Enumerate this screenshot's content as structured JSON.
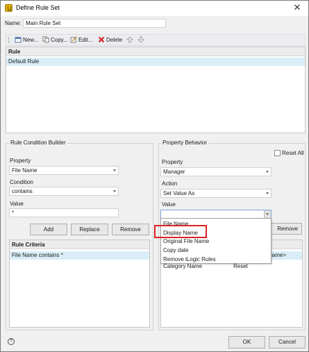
{
  "window": {
    "title": "Define Rule Set"
  },
  "name_field": {
    "label": "Name:",
    "value": "Main Rule Set"
  },
  "toolbar": {
    "new": "New...",
    "copy": "Copy...",
    "edit": "Edit...",
    "delete": "Delete"
  },
  "rule_grid": {
    "header": "Rule",
    "rows": [
      "Default Rule"
    ]
  },
  "condition_builder": {
    "title": "Rule Condition Builder",
    "property_label": "Property",
    "property_value": "File Name",
    "condition_label": "Condition",
    "condition_value": "contains",
    "value_label": "Value",
    "value_value": "*",
    "add": "Add",
    "replace": "Replace",
    "remove": "Remove"
  },
  "criteria_grid": {
    "header": "Rule Criteria",
    "rows": [
      "File Name contains *"
    ]
  },
  "property_behavior": {
    "title": "Property Behavior",
    "reset_all": "Reset All",
    "property_label": "Property",
    "property_value": "Manager",
    "action_label": "Action",
    "action_value": "Set Value As",
    "value_label": "Value",
    "value_value": "",
    "remove": "Remove",
    "grid_partial_cell": "Name>",
    "grid_row": {
      "name": "Category Name",
      "action": "Reset"
    }
  },
  "value_dropdown": {
    "options": [
      "File Name",
      "Display Name",
      "Original File Name",
      "Copy date",
      "Remove iLogic Rules"
    ],
    "highlighted": "Display Name"
  },
  "footer": {
    "ok": "OK",
    "cancel": "Cancel"
  },
  "colors": {
    "highlight_box": "#e02020",
    "selection_row": "#d9edf7",
    "dialog_bg": "#f0f0f0"
  }
}
